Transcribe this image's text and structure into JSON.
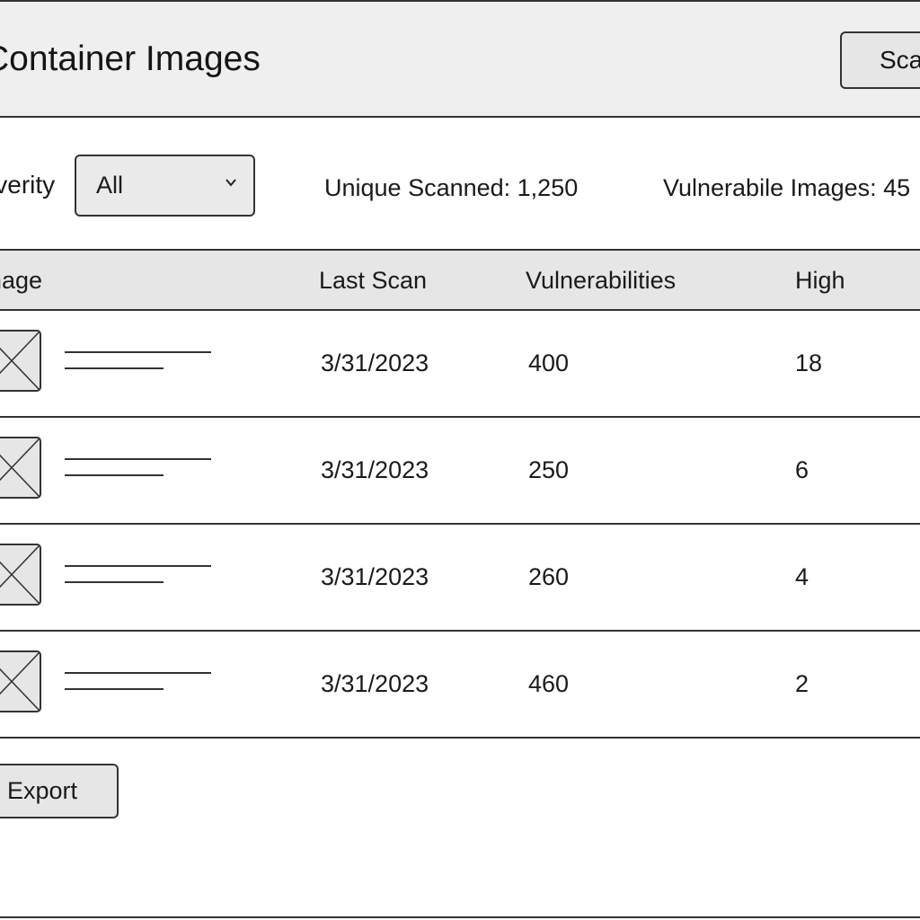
{
  "header": {
    "title": "Container Images",
    "scan_button_label": "Scan"
  },
  "filters": {
    "severity_label": "Severity",
    "severity_selected": "All",
    "unique_scanned": "Unique Scanned: 1,250",
    "vulnerable_images": "Vulnerabile Images: 45"
  },
  "table": {
    "columns": [
      "Image",
      "Last Scan",
      "Vulnerabilities",
      "High"
    ],
    "rows": [
      {
        "last_scan": "3/31/2023",
        "vulnerabilities": "400",
        "high": "18"
      },
      {
        "last_scan": "3/31/2023",
        "vulnerabilities": "250",
        "high": "6"
      },
      {
        "last_scan": "3/31/2023",
        "vulnerabilities": "260",
        "high": "4"
      },
      {
        "last_scan": "3/31/2023",
        "vulnerabilities": "460",
        "high": "2"
      }
    ]
  },
  "footer": {
    "export_label": "Export"
  },
  "icons": {
    "image_placeholder": "image-placeholder-icon",
    "dropdown": "chevron-down-icon"
  }
}
